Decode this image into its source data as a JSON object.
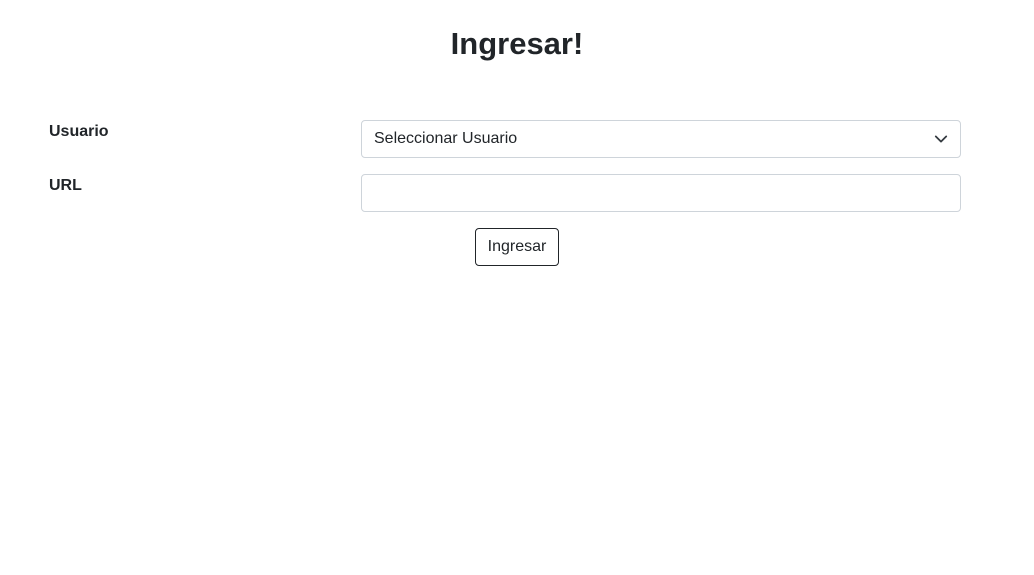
{
  "page": {
    "title": "Ingresar!"
  },
  "form": {
    "usuario_label": "Usuario",
    "usuario_select": {
      "selected": "Seleccionar Usuario"
    },
    "url_label": "URL",
    "url_input": {
      "value": "",
      "placeholder": ""
    },
    "submit_label": "Ingresar"
  },
  "colors": {
    "text": "#212529",
    "border": "#ced4da",
    "background": "#ffffff"
  }
}
